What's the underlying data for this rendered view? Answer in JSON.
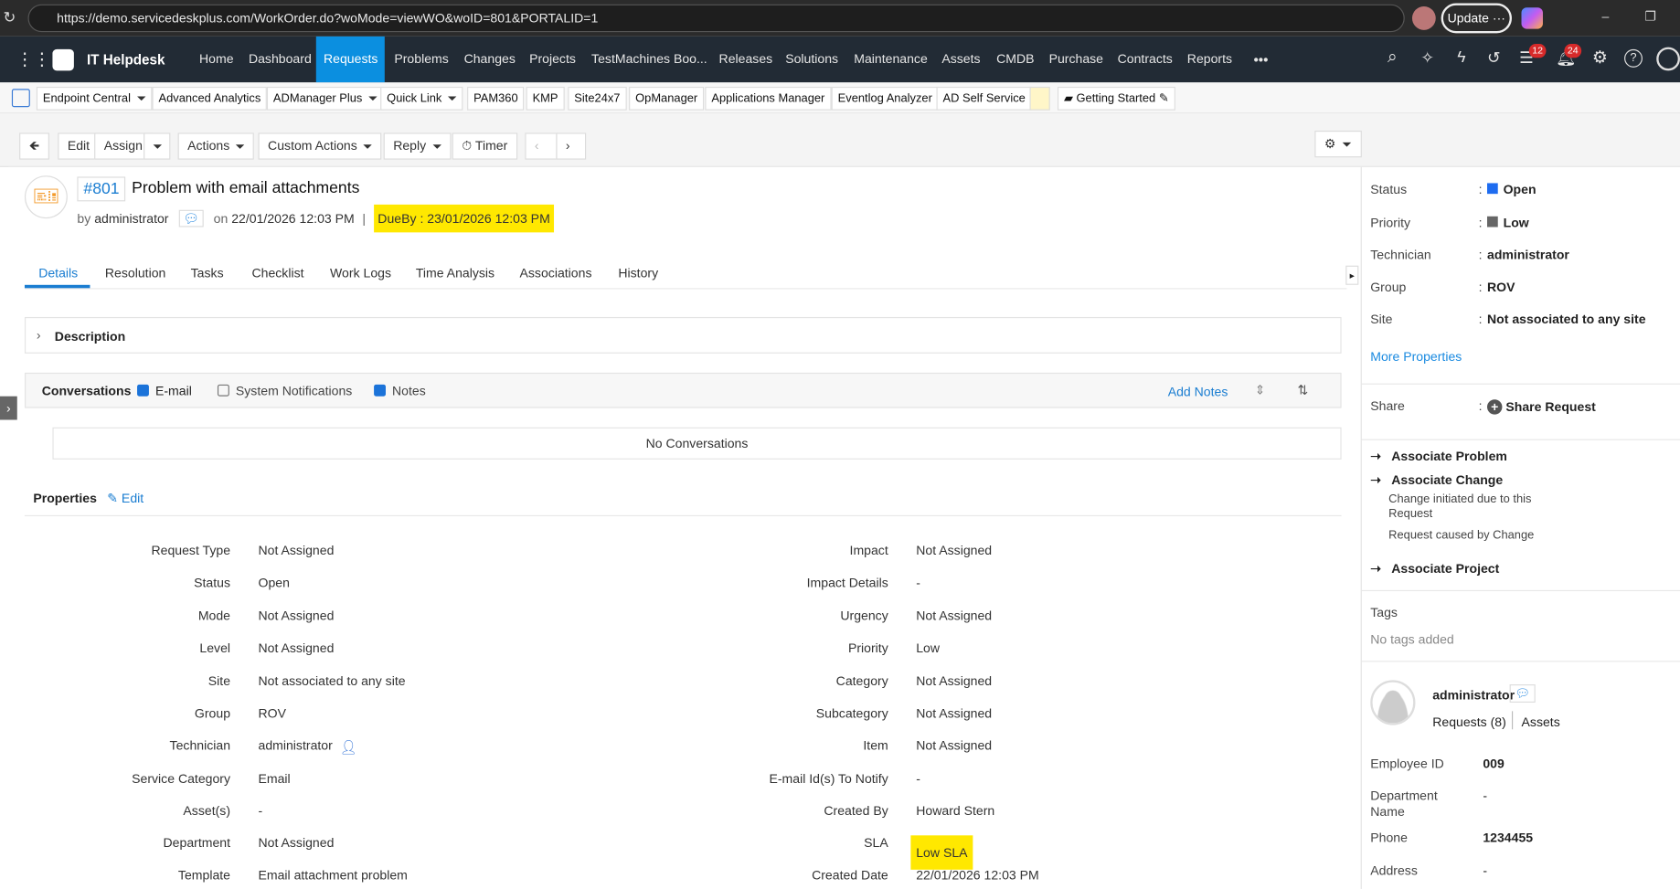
{
  "browser": {
    "url": "https://demo.servicedeskplus.com/WorkOrder.do?woMode=viewWO&woID=801&PORTALID=1",
    "update_label": "Update"
  },
  "nav": {
    "app_name": "IT Helpdesk",
    "items": [
      "Home",
      "Dashboard",
      "Requests",
      "Problems",
      "Changes",
      "Projects",
      "TestMachines Boo...",
      "Releases",
      "Solutions",
      "Maintenance",
      "Assets",
      "CMDB",
      "Purchase",
      "Contracts",
      "Reports"
    ],
    "active": "Requests",
    "more": "•••",
    "badges": {
      "tasks": "12",
      "notifications": "24"
    }
  },
  "links": [
    "Endpoint Central",
    "Advanced Analytics",
    "ADManager Plus",
    "Quick Link",
    "PAM360",
    "KMP",
    "Site24x7",
    "OpManager",
    "Applications Manager",
    "Eventlog Analyzer",
    "AD Self Service",
    "Getting Started"
  ],
  "toolbar": {
    "edit": "Edit",
    "assign": "Assign",
    "actions": "Actions",
    "custom_actions": "Custom Actions",
    "reply": "Reply",
    "timer": "Timer"
  },
  "request": {
    "id": "#801",
    "title": "Problem with email attachments",
    "by_label": "by",
    "author": "administrator",
    "on_label": "on",
    "created": "22/01/2026 12:03 PM",
    "due_label": "DueBy :",
    "due": "23/01/2026 12:03 PM"
  },
  "tabs": [
    "Details",
    "Resolution",
    "Tasks",
    "Checklist",
    "Work Logs",
    "Time Analysis",
    "Associations",
    "History"
  ],
  "description_label": "Description",
  "conversations": {
    "label": "Conversations",
    "email": "E-mail",
    "system": "System Notifications",
    "notes": "Notes",
    "add_notes": "Add Notes",
    "empty": "No Conversations"
  },
  "properties": {
    "label": "Properties",
    "edit": "Edit",
    "left": [
      [
        "Request Type",
        "Not Assigned"
      ],
      [
        "Status",
        "Open"
      ],
      [
        "Mode",
        "Not Assigned"
      ],
      [
        "Level",
        "Not Assigned"
      ],
      [
        "Site",
        "Not associated to any site"
      ],
      [
        "Group",
        "ROV"
      ],
      [
        "Technician",
        "administrator"
      ],
      [
        "Service Category",
        "Email"
      ],
      [
        "Asset(s)",
        "-"
      ],
      [
        "Department",
        "Not Assigned"
      ],
      [
        "Template",
        "Email attachment problem"
      ]
    ],
    "right": [
      [
        "Impact",
        "Not Assigned"
      ],
      [
        "Impact Details",
        "-"
      ],
      [
        "Urgency",
        "Not Assigned"
      ],
      [
        "Priority",
        "Low"
      ],
      [
        "Category",
        "Not Assigned"
      ],
      [
        "Subcategory",
        "Not Assigned"
      ],
      [
        "Item",
        "Not Assigned"
      ],
      [
        "E-mail Id(s) To Notify",
        "-"
      ],
      [
        "Created By",
        "Howard Stern"
      ],
      [
        "SLA",
        "Low SLA"
      ],
      [
        "Created Date",
        "22/01/2026 12:03 PM"
      ]
    ]
  },
  "side": {
    "fields": [
      [
        "Status",
        "Open"
      ],
      [
        "Priority",
        "Low"
      ],
      [
        "Technician",
        "administrator"
      ],
      [
        "Group",
        "ROV"
      ],
      [
        "Site",
        "Not associated to any site"
      ]
    ],
    "status_color": "#1e6cf0",
    "priority_color": "#666666",
    "more": "More Properties",
    "share_label": "Share",
    "share_request": "Share Request",
    "assoc_problem": "Associate Problem",
    "assoc_change": "Associate Change",
    "change_initiated": "Change initiated due to this Request",
    "request_caused": "Request caused by Change",
    "assoc_project": "Associate Project",
    "tags_label": "Tags",
    "no_tags": "No tags added",
    "user": "administrator",
    "requests": "Requests (8)",
    "assets": "Assets",
    "info": [
      [
        "Employee ID",
        "009"
      ],
      [
        "Department Name",
        "-"
      ],
      [
        "Phone",
        "1234455"
      ],
      [
        "Address",
        "-"
      ]
    ]
  }
}
